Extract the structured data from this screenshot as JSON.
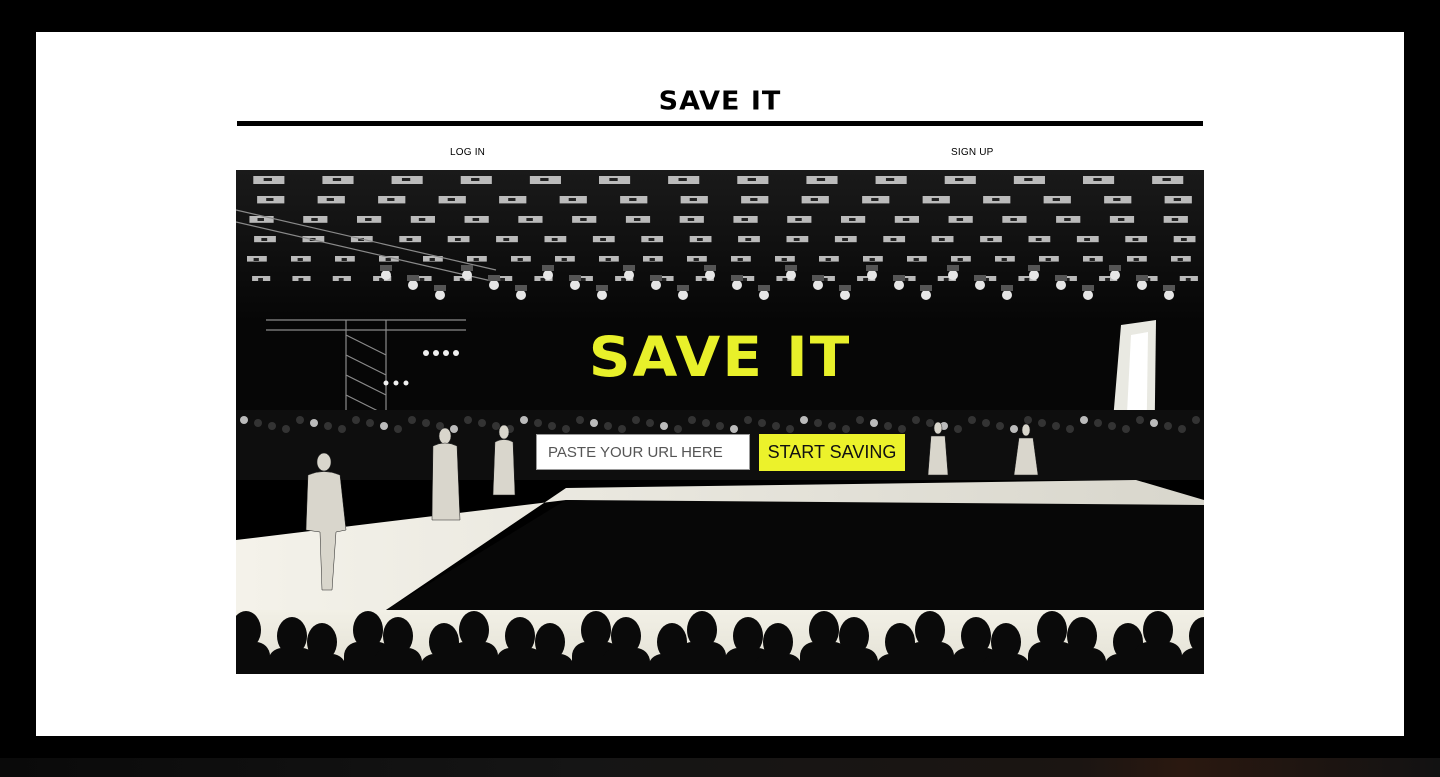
{
  "header": {
    "site_title": "SAVE IT"
  },
  "nav": {
    "login_label": "LOG IN",
    "signup_label": "SIGN UP"
  },
  "hero": {
    "title": "SAVE IT",
    "url_input": {
      "placeholder": "PASTE YOUR URL HERE",
      "value": ""
    },
    "start_button_label": "START SAVING"
  },
  "colors": {
    "accent_yellow": "#ECF22B",
    "background": "#000000",
    "panel": "#FFFFFF"
  }
}
